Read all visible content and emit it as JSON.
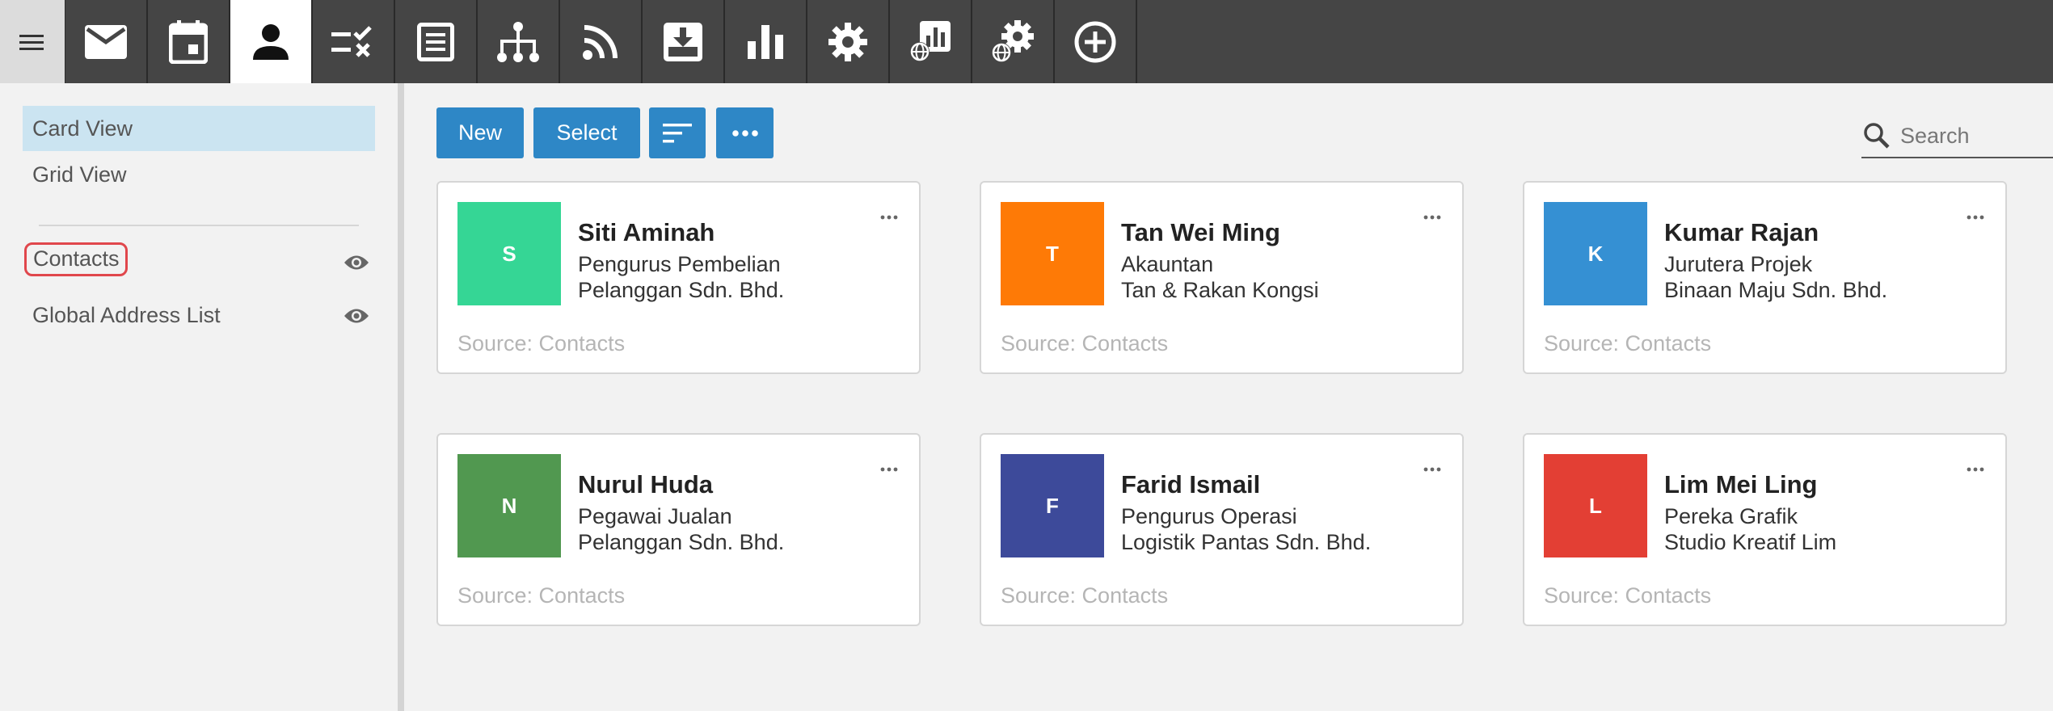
{
  "toolbar": {
    "icons": [
      "menu-icon",
      "mail-icon",
      "calendar-icon",
      "contacts-icon",
      "tasks-icon",
      "notes-icon",
      "org-chart-icon",
      "rss-icon",
      "archive-icon",
      "reports-icon",
      "settings-icon",
      "web-reports-icon",
      "web-settings-icon",
      "add-icon"
    ],
    "active": "contacts-icon"
  },
  "sidebar": {
    "views": [
      {
        "label": "Card View",
        "selected": true
      },
      {
        "label": "Grid View",
        "selected": false
      }
    ],
    "folders": [
      {
        "label": "Contacts",
        "icon": "eye-icon"
      },
      {
        "label": "Global Address List",
        "icon": "eye-icon"
      }
    ]
  },
  "actions": {
    "new_label": "New",
    "select_label": "Select",
    "sort_icon": "sort-icon",
    "more_icon": "more-icon"
  },
  "search": {
    "placeholder": "Search",
    "icon": "search-icon"
  },
  "contacts": [
    {
      "initial": "S",
      "name": "Siti Aminah",
      "title": "Pengurus Pembelian",
      "company": "Pelanggan Sdn. Bhd.",
      "source": "Source: Contacts",
      "color": "#35d695"
    },
    {
      "initial": "T",
      "name": "Tan Wei Ming",
      "title": "Akauntan",
      "company": "Tan & Rakan Kongsi",
      "source": "Source: Contacts",
      "color": "#fe7a06"
    },
    {
      "initial": "K",
      "name": "Kumar Rajan",
      "title": "Jurutera Projek",
      "company": "Binaan Maju Sdn. Bhd.",
      "source": "Source: Contacts",
      "color": "#3590d3"
    },
    {
      "initial": "N",
      "name": "Nurul Huda",
      "title": "Pegawai Jualan",
      "company": "Pelanggan Sdn. Bhd.",
      "source": "Source: Contacts",
      "color": "#519850"
    },
    {
      "initial": "F",
      "name": "Farid Ismail",
      "title": "Pengurus Operasi",
      "company": "Logistik Pantas Sdn. Bhd.",
      "source": "Source: Contacts",
      "color": "#3d4a9a"
    },
    {
      "initial": "L",
      "name": "Lim Mei Ling",
      "title": "Pereka Grafik",
      "company": "Studio Kreatif Lim",
      "source": "Source: Contacts",
      "color": "#e33f34"
    }
  ],
  "colors": {
    "toolbar_bg": "#454545",
    "accent": "#2e87c6",
    "selected_view": "#cbe4f1",
    "highlight_ring": "#e0474c"
  }
}
